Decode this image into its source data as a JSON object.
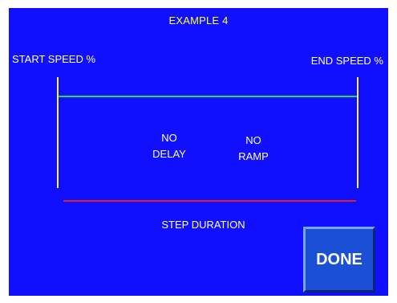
{
  "screen": {
    "title": "EXAMPLE 4",
    "start_speed_label": "START SPEED %",
    "end_speed_label": "END SPEED %",
    "delay": {
      "line1": "NO",
      "line2": "DELAY"
    },
    "ramp": {
      "line1": "NO",
      "line2": "RAMP"
    },
    "step_duration_label": "STEP DURATION",
    "done_label": "DONE"
  },
  "colors": {
    "background": "#1010ff",
    "title_text": "#ffff33",
    "vertical_lines": "#ffee55",
    "speed_line": "#22dd44",
    "duration_line": "#dd2222",
    "done_button": "#1a4fd6"
  }
}
